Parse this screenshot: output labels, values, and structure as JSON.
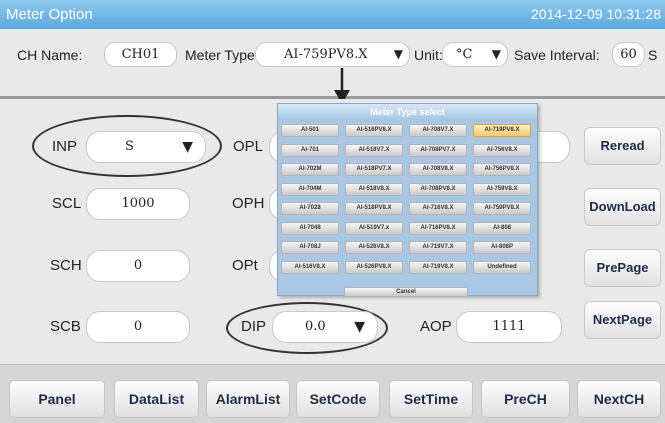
{
  "window": {
    "title": "Meter Option",
    "datetime": "2014-12-09 10:31:28"
  },
  "header": {
    "ch_name_label": "CH Name:",
    "ch_name_value": "CH01",
    "meter_type_label": "Meter Type:",
    "meter_type_value": "AI-759PV8.X",
    "unit_label": "Unit:",
    "unit_value": "°C",
    "save_interval_label": "Save Interval:",
    "save_interval_value": "60",
    "save_interval_unit": "S"
  },
  "params": {
    "inp_label": "INP",
    "inp_value": "S",
    "scl_label": "SCL",
    "scl_value": "1000",
    "sch_label": "SCH",
    "sch_value": "0",
    "scb_label": "SCB",
    "scb_value": "0",
    "opl_label": "OPL",
    "oph_label": "OPH",
    "opt_label": "OPt",
    "dip_label": "DIP",
    "dip_value": "0.0",
    "aop_label": "AOP",
    "aop_value": "1111"
  },
  "dropdown_arrow": "▼",
  "right_buttons": {
    "reread": "Reread",
    "download": "DownLoad",
    "prepage": "PrePage",
    "nextpage": "NextPage"
  },
  "bottom_buttons": {
    "panel": "Panel",
    "datalist": "DataList",
    "alarmlist": "AlarmList",
    "setcode": "SetCode",
    "settime": "SetTime",
    "prech": "PreCH",
    "nextch": "NextCH"
  },
  "popup": {
    "title": "Meter Type select",
    "options": [
      "AI-501",
      "AI-516PV8.X",
      "AI-708V7.X",
      "AI-719PV8.X",
      "AI-701",
      "AI-518V7.X",
      "AI-708PV7.X",
      "AI-756V8.X",
      "AI-702M",
      "AI-518PV7.X",
      "AI-708V8.X",
      "AI-756PV8.X",
      "AI-704M",
      "AI-518V8.X",
      "AI-708PV8.X",
      "AI-759V8.X",
      "AI-7028",
      "AI-518PV8.X",
      "AI-716V8.X",
      "AI-759PV8.X",
      "AI-7048",
      "AI-519V7.x",
      "AI-716PV8.X",
      "AI-808",
      "AI-708J",
      "AI-526V8.X",
      "AI-719V7.X",
      "AI-808P",
      "AI-516V8.X",
      "AI-526PV8.X",
      "AI-719V8.X",
      "Undefined"
    ],
    "selected": "AI-719PV8.X",
    "cancel": "Cancel"
  }
}
